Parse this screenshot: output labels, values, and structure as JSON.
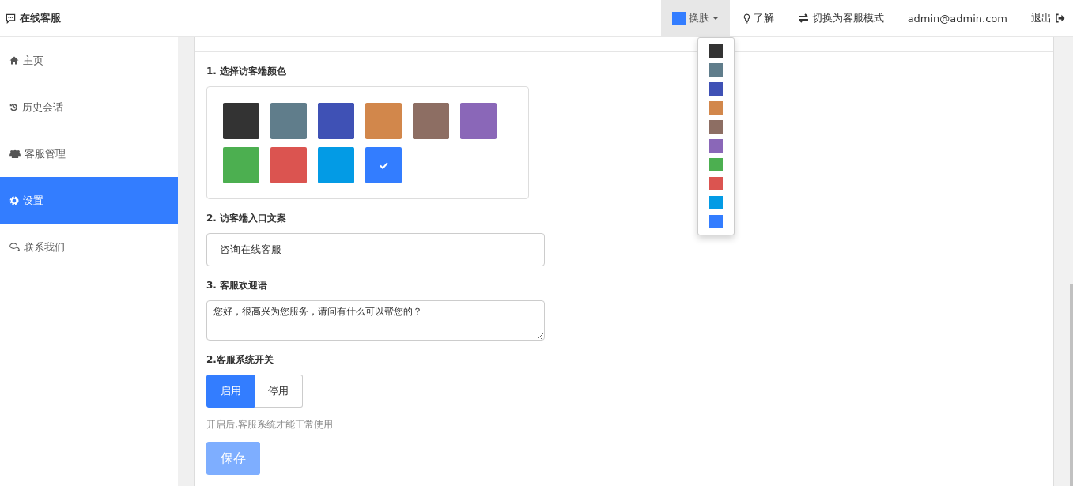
{
  "header": {
    "title": "在线客服",
    "skin": {
      "label": "换肤",
      "color": "#337dff",
      "expanded": true,
      "options": [
        {
          "color": "#333333"
        },
        {
          "color": "#607d8b"
        },
        {
          "color": "#3f51b5"
        },
        {
          "color": "#d2874b"
        },
        {
          "color": "#8d6e63"
        },
        {
          "color": "#8a67b8"
        },
        {
          "color": "#4caf50"
        },
        {
          "color": "#db5450"
        },
        {
          "color": "#039be5"
        },
        {
          "color": "#337dff"
        }
      ]
    },
    "links": [
      {
        "kind": "about",
        "label": "了解"
      },
      {
        "kind": "switch",
        "label": "切换为客服模式"
      },
      {
        "kind": "user",
        "label": "admin@admin.com"
      },
      {
        "kind": "logout",
        "label": "退出"
      }
    ]
  },
  "sidebar": {
    "items": [
      {
        "kind": "home",
        "label": "主页",
        "selected": false
      },
      {
        "kind": "history",
        "label": "历史会话",
        "selected": false
      },
      {
        "kind": "users",
        "label": "客服管理",
        "selected": false
      },
      {
        "kind": "settings",
        "label": "设置",
        "selected": true
      },
      {
        "kind": "contact",
        "label": "联系我们",
        "selected": false
      }
    ]
  },
  "settings": {
    "color_section": {
      "label": "1. 选择访客端颜色",
      "swatches": [
        {
          "color": "#333333",
          "selected": false
        },
        {
          "color": "#607d8b",
          "selected": false
        },
        {
          "color": "#3f51b5",
          "selected": false
        },
        {
          "color": "#d2874b",
          "selected": false
        },
        {
          "color": "#8d6e63",
          "selected": false
        },
        {
          "color": "#8a67b8",
          "selected": false
        },
        {
          "color": "#4caf50",
          "selected": false
        },
        {
          "color": "#db5450",
          "selected": false
        },
        {
          "color": "#039be5",
          "selected": false
        },
        {
          "color": "#337dff",
          "selected": true
        }
      ]
    },
    "entry_text": {
      "label": "2. 访客端入口文案",
      "value": "咨询在线客服"
    },
    "welcome": {
      "label": "3. 客服欢迎语",
      "value": "您好，很高兴为您服务，请问有什么可以帮您的？"
    },
    "switch": {
      "label": "2.客服系统开关",
      "options": [
        {
          "label": "启用",
          "selected": true
        },
        {
          "label": "停用",
          "selected": false
        }
      ],
      "help": "开启后,客服系统才能正常使用"
    },
    "save": {
      "label": "保存",
      "disabled": true
    }
  }
}
